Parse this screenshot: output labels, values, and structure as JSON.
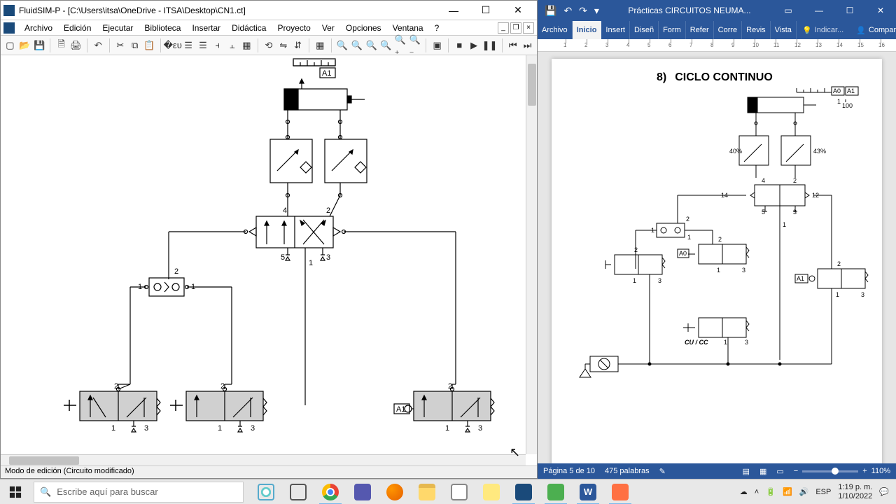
{
  "fluidsim": {
    "title": "FluidSIM-P - [C:\\Users\\itsa\\OneDrive - ITSA\\Desktop\\CN1.ct]",
    "menu": [
      "Archivo",
      "Edición",
      "Ejecutar",
      "Biblioteca",
      "Insertar",
      "Didáctica",
      "Proyecto",
      "Ver",
      "Opciones",
      "Ventana",
      "?"
    ],
    "status": "Modo de edición (Circuito modificado)",
    "canvas": {
      "labels": {
        "cyl": "A1",
        "valve_main_4": "4",
        "valve_main_2": "2",
        "valve_main_5": "5",
        "valve_main_3": "3",
        "or_2": "2",
        "or_1l": "1",
        "or_1r": "1",
        "bl_2": "2",
        "bl_1": "1",
        "bl_3": "3",
        "bm_2": "2",
        "bm_1": "1",
        "bm_3": "3",
        "br_2": "2",
        "br_1": "1",
        "br_3": "3",
        "br_cam": "A1"
      }
    }
  },
  "word": {
    "doc_name": "Prácticas CIRCUITOS NEUMA...",
    "tabs": [
      "Archivo",
      "Inicio",
      "Insert",
      "Diseñ",
      "Form",
      "Refer",
      "Corre",
      "Revis",
      "Vista"
    ],
    "tell": "Indicar...",
    "share": "Compartir",
    "heading_num": "8)",
    "heading_text": "CICLO CONTINUO",
    "status_page": "Página 5 de 10",
    "status_words": "475 palabras",
    "zoom": "110%",
    "diagram": {
      "a0": "A0",
      "a1": "A1",
      "hundred": "100",
      "forty": "40%",
      "fortythree": "43%",
      "fourteen": "14",
      "twelve": "12",
      "four": "4",
      "two": "2",
      "five": "5",
      "three": "3",
      "one": "1",
      "cu_cc": "CU / CC"
    }
  },
  "taskbar": {
    "search_placeholder": "Escribe aquí para buscar",
    "lang": "ESP",
    "time": "1:19 p. m.",
    "date": "1/10/2022"
  }
}
